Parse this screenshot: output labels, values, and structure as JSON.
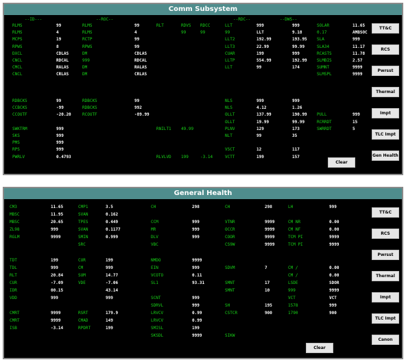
{
  "panel1": {
    "title": "Comm Subsystem",
    "buttons": [
      "TT&C",
      "RCS",
      "Pwrsst",
      "Thermal",
      "Impt",
      "TLC Impt",
      "Gen Health"
    ],
    "clear": "Clear",
    "hdr": [
      "--ID---",
      "--ROC--",
      "--RDC--",
      "--DWS--"
    ],
    "rows": [
      [
        "RLMS",
        "99",
        "RLMS",
        "99",
        "RLT",
        "RDVS",
        "RDCC",
        "LLT",
        "999",
        "999",
        "SOLAR",
        "11.65"
      ],
      [
        "RLMS",
        "4",
        "RLMS",
        "4",
        "",
        "99",
        "99",
        "99",
        "LLT",
        "9.18",
        "0.17",
        "AMBSOC",
        "11.93"
      ],
      [
        "MCPS",
        "19",
        "RCTP",
        "99",
        "",
        "",
        "",
        "LLT2",
        "192.99",
        "193.95",
        "SLA",
        "999"
      ],
      [
        "RPWS",
        "8",
        "RPWS",
        "99",
        "",
        "",
        "",
        "LLT3",
        "22.99",
        "99.99",
        "SLA34",
        "11.17"
      ],
      [
        "DXCL",
        "CDLAS",
        "DM",
        "CDLAS",
        "",
        "",
        "",
        "CUAR",
        "199",
        "999",
        "RCASTS",
        "11.78"
      ],
      [
        "CNCL",
        "RDCAL",
        "999",
        "RDCAL",
        "",
        "",
        "",
        "LLTP",
        "554.99",
        "192.99",
        "SLMBIS",
        "2.57"
      ],
      [
        "CMCL",
        "RALAS",
        "DM",
        "RALAS",
        "",
        "",
        "",
        "LLT",
        "99",
        "174",
        "SUMNT",
        "9999"
      ],
      [
        "CNCL",
        "CRLAS",
        "DM",
        "CRLAS",
        "",
        "",
        "",
        "",
        "",
        "",
        "SLMSPL",
        "9999"
      ]
    ],
    "rows2": [
      [
        "RDBCKS",
        "99",
        "RDBCKS",
        "99",
        "",
        "",
        "",
        "NLS",
        "999",
        "999",
        "",
        ""
      ],
      [
        "CCBCKS",
        "-99",
        "RDBCKS",
        "992",
        "",
        "",
        "",
        "NLS",
        "4.12",
        "1.26",
        "",
        ""
      ],
      [
        "CCOUTF",
        "-20.20",
        "RCOUTF",
        "-89.99",
        "",
        "",
        "",
        "OLLT",
        "137.99",
        "190.99",
        "PULL",
        "999"
      ],
      [
        "",
        "",
        "",
        "",
        "",
        "",
        "",
        "OLLT",
        "19.99",
        "99.99",
        "RCRRDT",
        "15"
      ],
      [
        "SWKTRM",
        "999",
        "",
        "",
        "RNILT1",
        "49.99",
        "",
        "PLNV",
        "129",
        "173",
        "SWRRDT",
        "5"
      ],
      [
        "SKS",
        "999",
        "",
        "",
        "",
        "",
        "",
        "NLT",
        "99",
        "35",
        "",
        ""
      ],
      [
        "PMS",
        "999",
        "",
        "",
        "",
        "",
        "",
        "",
        "",
        "",
        "",
        ""
      ],
      [
        "RPS",
        "999",
        "",
        "",
        "",
        "",
        "",
        "VSCT",
        "12",
        "117",
        "",
        ""
      ],
      [
        "PWRLV",
        "0.4793",
        "",
        "",
        "RLVLVD",
        "199",
        "-3.14",
        "VCTT",
        "199",
        "157",
        "",
        ""
      ]
    ]
  },
  "panel2": {
    "title": "General Health",
    "buttons": [
      "TT&C",
      "RCS",
      "Pwrsst",
      "Thermal",
      "Impt",
      "TLC Impt",
      "Canon"
    ],
    "clear": "Clear",
    "rows": [
      [
        "CM3",
        "11.65",
        "CMP1",
        "3.5",
        "CH",
        "298",
        "CH",
        "298",
        "LH",
        "999"
      ],
      [
        "MBSC",
        "11.95",
        "SVAN",
        "0.162",
        "",
        "",
        "",
        "",
        "",
        ""
      ],
      [
        "MBSC",
        "20.65",
        "TPES",
        "0.449",
        "CCM",
        "999",
        "VTNR",
        "9999",
        "CM NR",
        "0.00"
      ],
      [
        "ZL98",
        "999",
        "SVAN",
        "0.1177",
        "MR",
        "999",
        "OCCR",
        "9999",
        "CM NF",
        "0.00"
      ],
      [
        "RGLM",
        "9999",
        "SMIN",
        "0.999",
        "DLV",
        "999",
        "COOR",
        "9999",
        "TCM PI",
        "9999"
      ],
      [
        "",
        "",
        "SRC",
        "",
        "VBC",
        "",
        "CS9W",
        "9999",
        "TCM PI",
        "9999"
      ]
    ],
    "rows2": [
      [
        "TDT",
        "199",
        "CUR",
        "199",
        "NMDO",
        "9999",
        "",
        "",
        "",
        ""
      ],
      [
        "TDL",
        "999",
        "CM",
        "999",
        "EIN",
        "999",
        "SDVM",
        "7",
        "CM /",
        "0.00"
      ],
      [
        "RLT",
        "20.84",
        "SUM",
        "14.77",
        "VCOTO",
        "0.11",
        "",
        "",
        "CM /",
        "0.00"
      ],
      [
        "CUR",
        "-7.09",
        "VDE",
        "-7.06",
        "SL1",
        "93.31",
        "SMNT",
        "17",
        "LSDE",
        "SDOR"
      ],
      [
        "IDR",
        "00.15",
        "",
        "43.14",
        "",
        "",
        "SMNT",
        "10",
        "999",
        "9999"
      ],
      [
        "VDD",
        "999",
        "",
        "999",
        "SCNT",
        "999",
        "",
        "",
        "VCT",
        "VCT"
      ],
      [
        "",
        "",
        "",
        "",
        "SDRVL",
        "999",
        "SH",
        "195",
        "1578",
        "999"
      ],
      [
        "CMRT",
        "9999",
        "RSRT",
        "179.9",
        "LRVCV",
        "0.99",
        "CSTCR",
        "900",
        "1790",
        "900"
      ],
      [
        "CMRT",
        "9999",
        "CMAD",
        "149",
        "LRVCV",
        "0.99",
        "",
        "",
        "",
        ""
      ],
      [
        "ISB",
        "-3.14",
        "RPDRT",
        "199",
        "SMISL",
        "199",
        "",
        "",
        "",
        ""
      ],
      [
        "",
        "",
        "",
        "",
        "SKSDL",
        "9999",
        "SIKW",
        "",
        "",
        ""
      ]
    ]
  },
  "colors": {
    "title_bar": "#4f8d8d",
    "text": "#18d418",
    "value": "#ffffff",
    "bg": "#000000"
  }
}
